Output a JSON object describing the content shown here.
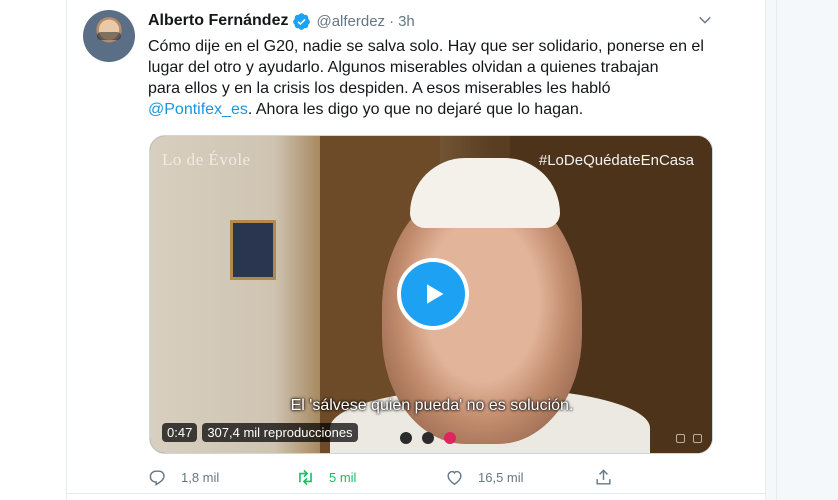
{
  "tweet": {
    "author": {
      "name": "Alberto Fernández",
      "handle": "@alferdez",
      "separator": "·",
      "time": "3h"
    },
    "text": {
      "line1": "Cómo dije en el G20, nadie se salva solo. Hay que ser solidario, ponerse en el",
      "line2": "lugar del otro y ayudarlo. Algunos miserables olvidan a quienes trabajan",
      "line3": "para ellos y en la crisis los despiden. A esos miserables les habló",
      "mention": "@Pontifex_es",
      "line4_rest": ". Ahora les digo yo que no dejaré que lo hagan."
    },
    "video": {
      "brand": "Lo de Évole",
      "hashtag": "#LoDeQuédateEnCasa",
      "subtitle": "El 'sálvese quien pueda' no es solución.",
      "duration": "0:47",
      "views": "307,4 mil reproducciones",
      "play_icon": "play-icon"
    },
    "actions": {
      "reply_count": "1,8 mil",
      "retweet_count": "5 mil",
      "like_count": "16,5 mil"
    }
  },
  "colors": {
    "accent": "#1da1f2",
    "mention": "#1b95e0",
    "retweet": "#17bf63",
    "muted": "#657786",
    "text": "#14171a"
  }
}
